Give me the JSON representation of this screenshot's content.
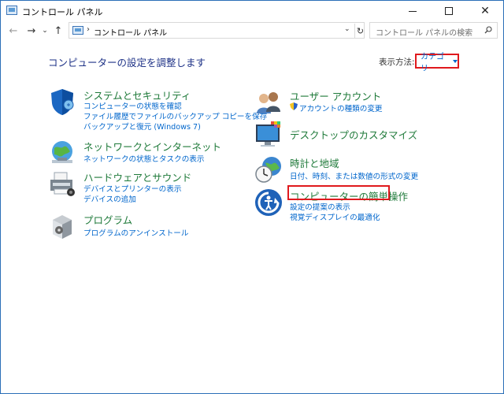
{
  "window": {
    "title": "コントロール パネル"
  },
  "address": {
    "path": "コントロール パネル",
    "search_placeholder": "コントロール パネルの検索"
  },
  "heading": "コンピューターの設定を調整します",
  "view_by": {
    "label": "表示方法:",
    "value": "カテゴリ"
  },
  "categories_left": [
    {
      "title": "システムとセキュリティ",
      "links": [
        "コンピューターの状態を確認",
        "ファイル履歴でファイルのバックアップ コピーを保存",
        "バックアップと復元 (Windows 7)"
      ]
    },
    {
      "title": "ネットワークとインターネット",
      "links": [
        "ネットワークの状態とタスクの表示"
      ]
    },
    {
      "title": "ハードウェアとサウンド",
      "links": [
        "デバイスとプリンターの表示",
        "デバイスの追加"
      ]
    },
    {
      "title": "プログラム",
      "links": [
        "プログラムのアンインストール"
      ]
    }
  ],
  "categories_right": [
    {
      "title": "ユーザー アカウント",
      "links": [
        "アカウントの種類の変更"
      ]
    },
    {
      "title": "デスクトップのカスタマイズ",
      "links": []
    },
    {
      "title": "時計と地域",
      "links": [
        "日付、時刻、または数値の形式の変更"
      ]
    },
    {
      "title": "コンピューターの簡単操作",
      "links": [
        "設定の提案の表示",
        "視覚ディスプレイの最適化"
      ]
    }
  ],
  "colors": {
    "heading": "#1e3287",
    "category": "#1f7a3a",
    "link": "#0066cc",
    "highlight": "#e0191d"
  },
  "icons": [
    "shield-icon",
    "network-globe-icon",
    "printer-icon",
    "program-box-icon",
    "users-icon",
    "desktop-monitor-icon",
    "clock-globe-icon",
    "ease-of-access-icon"
  ]
}
